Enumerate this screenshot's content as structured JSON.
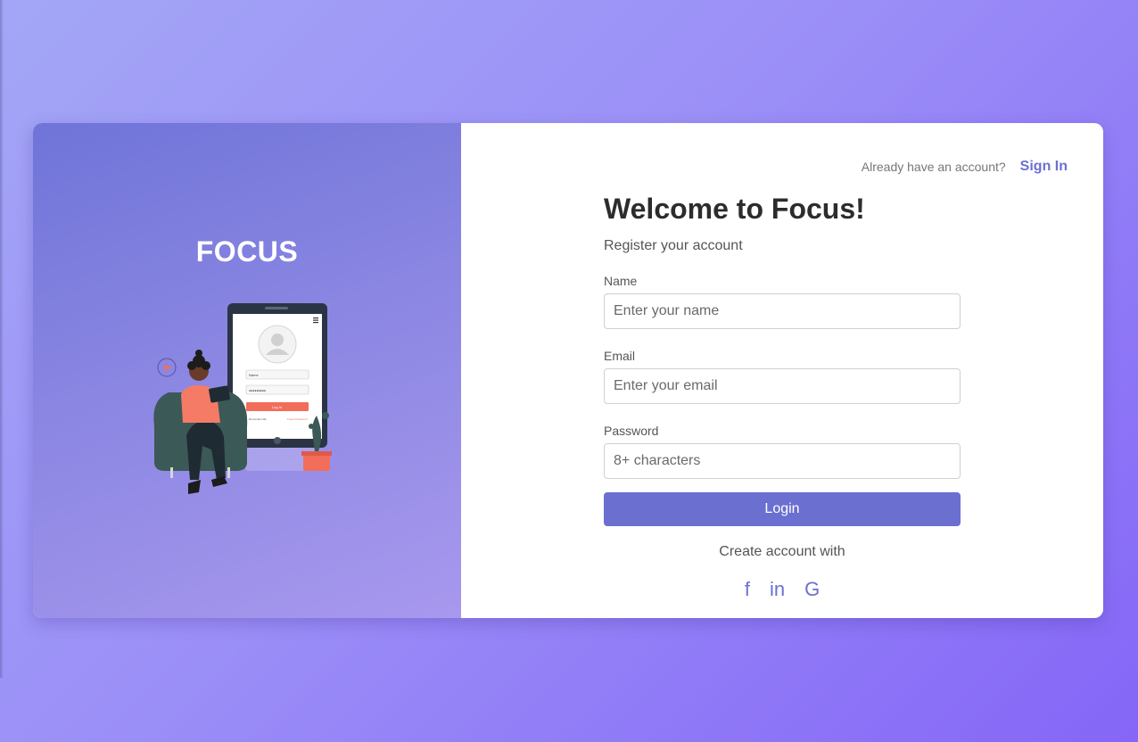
{
  "brand": {
    "name": "FOCUS"
  },
  "header": {
    "prompt": "Already have an account?",
    "signin_label": "Sign In"
  },
  "form": {
    "title": "Welcome to Focus!",
    "subtitle": "Register your account",
    "name": {
      "label": "Name",
      "placeholder": "Enter your name",
      "value": ""
    },
    "email": {
      "label": "Email",
      "placeholder": "Enter your email",
      "value": ""
    },
    "password": {
      "label": "Password",
      "placeholder": "8+ characters",
      "value": ""
    },
    "submit_label": "Login"
  },
  "social": {
    "heading": "Create account with",
    "providers": [
      {
        "glyph": "f",
        "icon": "facebook-icon"
      },
      {
        "glyph": "in",
        "icon": "linkedin-icon"
      },
      {
        "glyph": "G",
        "icon": "google-icon"
      }
    ]
  },
  "illustration": {
    "phone_field_name": "Name",
    "phone_field_password": "●●●●●●●●●",
    "phone_login_label": "Log In",
    "phone_remember": "Remember Me",
    "phone_forgot": "Forgot Password"
  },
  "colors": {
    "accent": "#6a6fd0",
    "panel_gradient_start": "#6f74d8",
    "panel_gradient_end": "#a898ee",
    "phone_button": "#f26e5b"
  }
}
